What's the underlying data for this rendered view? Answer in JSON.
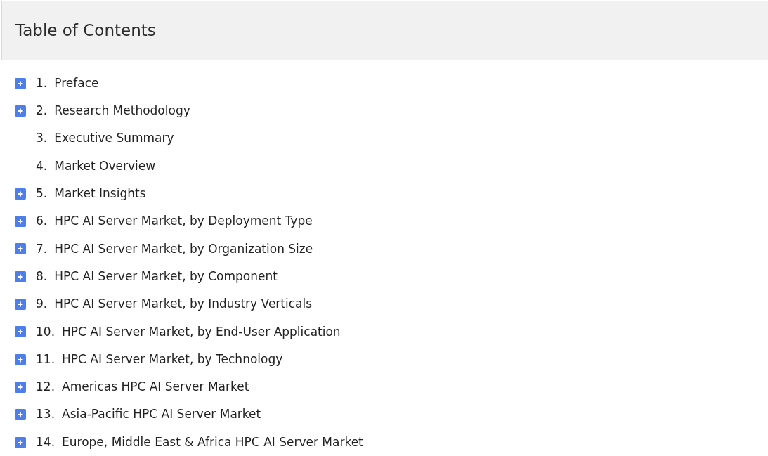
{
  "title": "Table of Contents",
  "items": [
    {
      "number": "1.",
      "label": "Preface",
      "expandable": true
    },
    {
      "number": "2.",
      "label": "Research Methodology",
      "expandable": true
    },
    {
      "number": "3.",
      "label": "Executive Summary",
      "expandable": false
    },
    {
      "number": "4.",
      "label": "Market Overview",
      "expandable": false
    },
    {
      "number": "5.",
      "label": "Market Insights",
      "expandable": true
    },
    {
      "number": "6.",
      "label": "HPC AI Server Market, by Deployment Type",
      "expandable": true
    },
    {
      "number": "7.",
      "label": "HPC AI Server Market, by Organization Size",
      "expandable": true
    },
    {
      "number": "8.",
      "label": "HPC AI Server Market, by Component",
      "expandable": true
    },
    {
      "number": "9.",
      "label": "HPC AI Server Market, by Industry Verticals",
      "expandable": true
    },
    {
      "number": "10.",
      "label": "HPC AI Server Market, by End-User Application",
      "expandable": true
    },
    {
      "number": "11.",
      "label": "HPC AI Server Market, by Technology",
      "expandable": true
    },
    {
      "number": "12.",
      "label": "Americas HPC AI Server Market",
      "expandable": true
    },
    {
      "number": "13.",
      "label": "Asia-Pacific HPC AI Server Market",
      "expandable": true
    },
    {
      "number": "14.",
      "label": "Europe, Middle East & Africa HPC AI Server Market",
      "expandable": true
    }
  ]
}
